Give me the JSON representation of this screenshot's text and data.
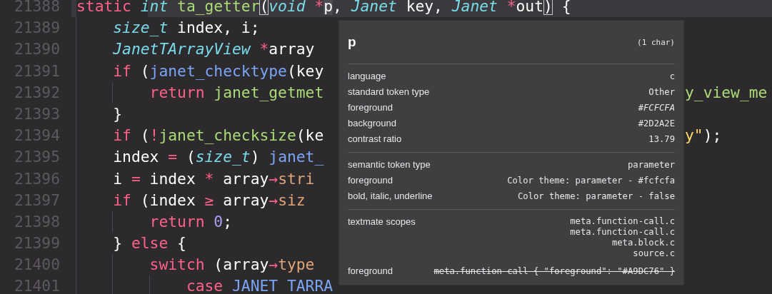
{
  "editor": {
    "lines": [
      {
        "number": "21388",
        "current": true,
        "tokens": [
          {
            "kind": "kw",
            "text": "static "
          },
          {
            "kind": "type",
            "text": "int "
          },
          {
            "kind": "fn",
            "text": "ta_getter"
          },
          {
            "kind": "bracket",
            "text": "("
          },
          {
            "kind": "type",
            "text": "void "
          },
          {
            "kind": "kw",
            "text": "*"
          },
          {
            "kind": "hl",
            "text": "p"
          },
          {
            "kind": "plain",
            "text": ", "
          },
          {
            "kind": "type",
            "text": "Janet"
          },
          {
            "kind": "plain",
            "text": " key, "
          },
          {
            "kind": "type",
            "text": "Janet "
          },
          {
            "kind": "kw",
            "text": "*"
          },
          {
            "kind": "plain",
            "text": "out"
          },
          {
            "kind": "bracket",
            "text": ")"
          },
          {
            "kind": "plain",
            "text": " {"
          }
        ]
      },
      {
        "number": "21389",
        "current": false,
        "tokens": [
          {
            "kind": "type",
            "text": "    size_t"
          },
          {
            "kind": "plain",
            "text": " index, i;"
          }
        ]
      },
      {
        "number": "21390",
        "current": false,
        "tokens": [
          {
            "kind": "type",
            "text": "    JanetTArrayView "
          },
          {
            "kind": "kw",
            "text": "*"
          },
          {
            "kind": "plain",
            "text": "array"
          }
        ]
      },
      {
        "number": "21391",
        "current": false,
        "tokens": [
          {
            "kind": "kw",
            "text": "    if"
          },
          {
            "kind": "plain",
            "text": " ("
          },
          {
            "kind": "call",
            "text": "janet_checktype"
          },
          {
            "kind": "plain",
            "text": "(key"
          }
        ]
      },
      {
        "number": "21392",
        "current": false,
        "tokens": [
          {
            "kind": "kw",
            "text": "        return "
          },
          {
            "kind": "fn",
            "text": "janet_getmet"
          }
        ],
        "after": [
          {
            "kind": "fn",
            "text": "y_view_me"
          }
        ]
      },
      {
        "number": "21393",
        "current": false,
        "tokens": [
          {
            "kind": "plain",
            "text": "    }"
          }
        ]
      },
      {
        "number": "21394",
        "current": false,
        "tokens": [
          {
            "kind": "kw",
            "text": "    if"
          },
          {
            "kind": "plain",
            "text": " ("
          },
          {
            "kind": "kw",
            "text": "!"
          },
          {
            "kind": "fn",
            "text": "janet_checksize"
          },
          {
            "kind": "plain",
            "text": "(ke"
          }
        ],
        "after": [
          {
            "kind": "str",
            "text": "y\""
          },
          {
            "kind": "plain",
            "text": ");"
          }
        ]
      },
      {
        "number": "21395",
        "current": false,
        "tokens": [
          {
            "kind": "plain",
            "text": "    index "
          },
          {
            "kind": "kw",
            "text": "="
          },
          {
            "kind": "plain",
            "text": " ("
          },
          {
            "kind": "type",
            "text": "size_t"
          },
          {
            "kind": "plain",
            "text": ") "
          },
          {
            "kind": "call",
            "text": "janet_"
          }
        ]
      },
      {
        "number": "21396",
        "current": false,
        "tokens": [
          {
            "kind": "plain",
            "text": "    i "
          },
          {
            "kind": "kw",
            "text": "="
          },
          {
            "kind": "plain",
            "text": " index "
          },
          {
            "kind": "kw",
            "text": "*"
          },
          {
            "kind": "plain",
            "text": " array"
          },
          {
            "kind": "kw",
            "text": "→"
          },
          {
            "kind": "prop",
            "text": "stri"
          }
        ]
      },
      {
        "number": "21397",
        "current": false,
        "tokens": [
          {
            "kind": "kw",
            "text": "    if"
          },
          {
            "kind": "plain",
            "text": " (index "
          },
          {
            "kind": "kw",
            "text": "≥"
          },
          {
            "kind": "plain",
            "text": " array"
          },
          {
            "kind": "kw",
            "text": "→"
          },
          {
            "kind": "prop",
            "text": "siz"
          }
        ]
      },
      {
        "number": "21398",
        "current": false,
        "tokens": [
          {
            "kind": "kw",
            "text": "        return "
          },
          {
            "kind": "num",
            "text": "0"
          },
          {
            "kind": "plain",
            "text": ";"
          }
        ]
      },
      {
        "number": "21399",
        "current": false,
        "tokens": [
          {
            "kind": "plain",
            "text": "    } "
          },
          {
            "kind": "kw",
            "text": "else"
          },
          {
            "kind": "plain",
            "text": " {"
          }
        ]
      },
      {
        "number": "21400",
        "current": false,
        "tokens": [
          {
            "kind": "kw",
            "text": "        switch"
          },
          {
            "kind": "plain",
            "text": " (array"
          },
          {
            "kind": "kw",
            "text": "→"
          },
          {
            "kind": "prop",
            "text": "type"
          }
        ]
      },
      {
        "number": "21401",
        "current": false,
        "tokens": [
          {
            "kind": "kw",
            "text": "            case "
          },
          {
            "kind": "call",
            "text": "JANET_TARRA"
          }
        ]
      }
    ]
  },
  "hover": {
    "title": "p",
    "length": "(1 char)",
    "sections": [
      {
        "rows": [
          {
            "label": "language",
            "value": "c",
            "italic": false,
            "struck": false
          },
          {
            "label": "standard token type",
            "value": "Other",
            "italic": false,
            "struck": false
          },
          {
            "label": "foreground",
            "value": "#FCFCFA",
            "italic": true,
            "struck": false
          },
          {
            "label": "background",
            "value": "#2D2A2E",
            "italic": false,
            "struck": false
          },
          {
            "label": "contrast ratio",
            "value": "13.79",
            "italic": false,
            "struck": false
          }
        ]
      },
      {
        "rows": [
          {
            "label": "semantic token type",
            "value": "parameter",
            "italic": false,
            "struck": false
          },
          {
            "label": "foreground",
            "value": "Color theme: parameter - #fcfcfa",
            "italic": false,
            "struck": false
          },
          {
            "label": "bold, italic, underline",
            "value": "Color theme: parameter - false",
            "italic": false,
            "struck": false
          }
        ]
      },
      {
        "rows": [
          {
            "label": "textmate scopes",
            "lines": [
              "meta.function-call.c",
              "meta.function-call.c",
              "meta.block.c",
              "source.c"
            ]
          },
          {
            "label": "foreground",
            "value": "meta.function-call { \"foreground\": \"#A9DC76\" }",
            "italic": false,
            "struck": true
          }
        ]
      }
    ]
  }
}
